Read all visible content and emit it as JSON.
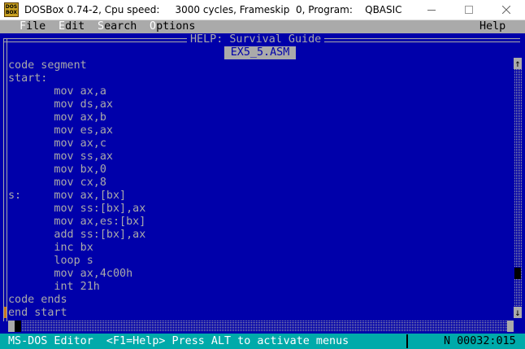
{
  "window": {
    "title": "DOSBox 0.74-2, Cpu speed:     3000 cycles, Frameskip  0, Program:    QBASIC",
    "icon_text": "DOS BOX",
    "controls": [
      "minimize-icon",
      "maximize-icon",
      "close-icon"
    ]
  },
  "menu": {
    "items": [
      {
        "hot": "F",
        "rest": "ile"
      },
      {
        "hot": "E",
        "rest": "dit"
      },
      {
        "hot": "S",
        "rest": "earch"
      },
      {
        "hot": "O",
        "rest": "ptions"
      }
    ],
    "help": "Help"
  },
  "editor": {
    "window_title": "HELP: Survival Guide",
    "file_name": "EX5_5.ASM",
    "lines": [
      "code segment",
      "start:",
      "       mov ax,a",
      "       mov ds,ax",
      "       mov ax,b",
      "       mov es,ax",
      "       mov ax,c",
      "       mov ss,ax",
      "       mov bx,0",
      "       mov cx,8",
      "s:     mov ax,[bx]",
      "       mov ss:[bx],ax",
      "       mov ax,es:[bx]",
      "       add ss:[bx],ax",
      "       inc bx",
      "       loop s",
      "       mov ax,4c00h",
      "       int 21h",
      "code ends",
      "end start"
    ]
  },
  "scrollbars": {
    "up_arrow": "↑",
    "down_arrow": "↓"
  },
  "status": {
    "message": "MS-DOS Editor  <F1=Help> Press ALT to activate menus",
    "position": "N 00032:015"
  },
  "colors": {
    "background": "#0000aa",
    "text": "#aaaaaa",
    "menu_bar": "#aaaaaa",
    "status_bar": "#00aaaa",
    "cursor": "#c87820"
  }
}
